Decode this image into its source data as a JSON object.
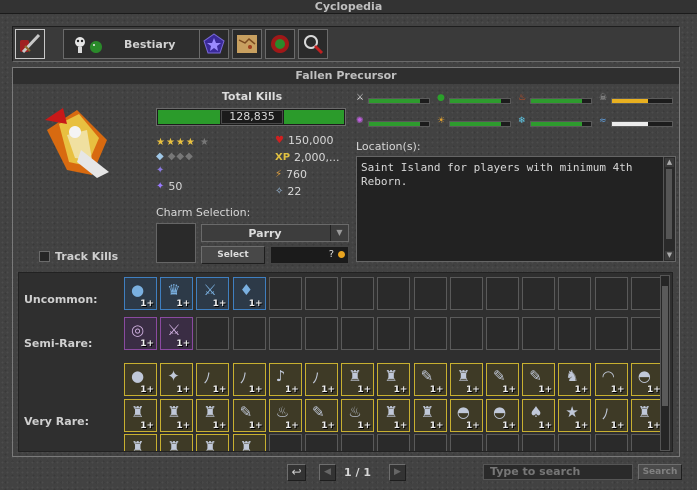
{
  "window": {
    "title": "Cyclopedia"
  },
  "tabs": {
    "bestiary_label": "Bestiary",
    "icons": [
      "items-tab-icon",
      "charms-tab-icon",
      "map-tab-icon",
      "boss-tab-icon",
      "search-tab-icon"
    ]
  },
  "panel": {
    "title": "Fallen Precursor",
    "total_kills_label": "Total Kills",
    "total_kills_value": "128,835",
    "difficulty_stars": 4,
    "occurrence_diamonds": 0,
    "charm_points": "50",
    "hitpoints": "150,000",
    "experience": "2,000,...",
    "speed": "760",
    "armor": "22",
    "resistances": [
      {
        "name": "physical",
        "level": 0.85,
        "color": "#2e9b2e"
      },
      {
        "name": "earth",
        "level": 0.85,
        "color": "#2e9b2e"
      },
      {
        "name": "fire",
        "level": 0.85,
        "color": "#2e9b2e"
      },
      {
        "name": "death",
        "level": 0.6,
        "color": "#e8b020"
      },
      {
        "name": "energy",
        "level": 0.85,
        "color": "#2e9b2e"
      },
      {
        "name": "holy",
        "level": 0.85,
        "color": "#2e9b2e"
      },
      {
        "name": "ice",
        "level": 0.85,
        "color": "#2e9b2e"
      },
      {
        "name": "drown",
        "level": 0.6,
        "color": "#ececec"
      }
    ],
    "locations_label": "Location(s):",
    "locations_text": "Saint Island for players with minimum 4th Reborn.",
    "charm_selection_label": "Charm Selection:",
    "charm_dropdown_value": "Parry",
    "select_button": "Select",
    "charm_cost": "?",
    "track_kills_label": "Track Kills"
  },
  "loot": {
    "uncommon_label": "Uncommon:",
    "semirare_label": "Semi-Rare:",
    "veryrare_label": "Very Rare:",
    "count_label": "1+"
  },
  "footer": {
    "page": "1 / 1",
    "search_placeholder": "Type to search",
    "search_button": "Search"
  }
}
